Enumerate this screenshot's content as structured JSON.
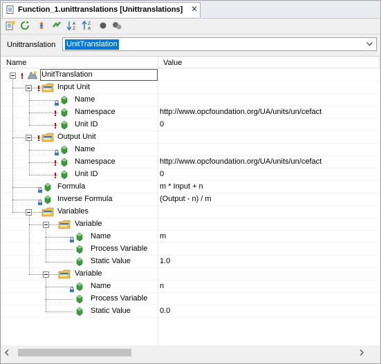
{
  "tab": {
    "title": "Function_1.unittranslations [Unittranslations]",
    "close": "✕"
  },
  "toolbar": {
    "buttons": [
      "new-icon",
      "refresh-icon",
      "move-icon",
      "link-icon",
      "sort-desc-icon",
      "sort-asc-icon",
      "record-icon",
      "settings-icon"
    ]
  },
  "selector": {
    "label": "Unittranslation",
    "value": "UnitTranslation"
  },
  "grid": {
    "columns": {
      "name": "Name",
      "value": "Value"
    },
    "rows": [
      {
        "name": "UnitTranslation",
        "value": ""
      },
      {
        "name": "Input Unit",
        "value": ""
      },
      {
        "name": "Name",
        "value": ""
      },
      {
        "name": "Namespace",
        "value": "http://www.opcfoundation.org/UA/units/un/cefact"
      },
      {
        "name": "Unit ID",
        "value": "0"
      },
      {
        "name": "Output Unit",
        "value": ""
      },
      {
        "name": "Name",
        "value": ""
      },
      {
        "name": "Namespace",
        "value": "http://www.opcfoundation.org/UA/units/un/cefact"
      },
      {
        "name": "Unit ID",
        "value": "0"
      },
      {
        "name": "Formula",
        "value": "m * Input + n"
      },
      {
        "name": "Inverse Formula",
        "value": "(Output - n) / m"
      },
      {
        "name": "Variables",
        "value": ""
      },
      {
        "name": "Variable",
        "value": ""
      },
      {
        "name": "Name",
        "value": "m"
      },
      {
        "name": "Process Variable",
        "value": ""
      },
      {
        "name": "Static Value",
        "value": "1.0"
      },
      {
        "name": "Variable",
        "value": ""
      },
      {
        "name": "Name",
        "value": "n"
      },
      {
        "name": "Process Variable",
        "value": ""
      },
      {
        "name": "Static Value",
        "value": "0.0"
      }
    ]
  },
  "colors": {
    "selection": "#0078d7",
    "gem": "#3f9a3f",
    "error": "#d40000",
    "folder": "#e8c25a"
  }
}
